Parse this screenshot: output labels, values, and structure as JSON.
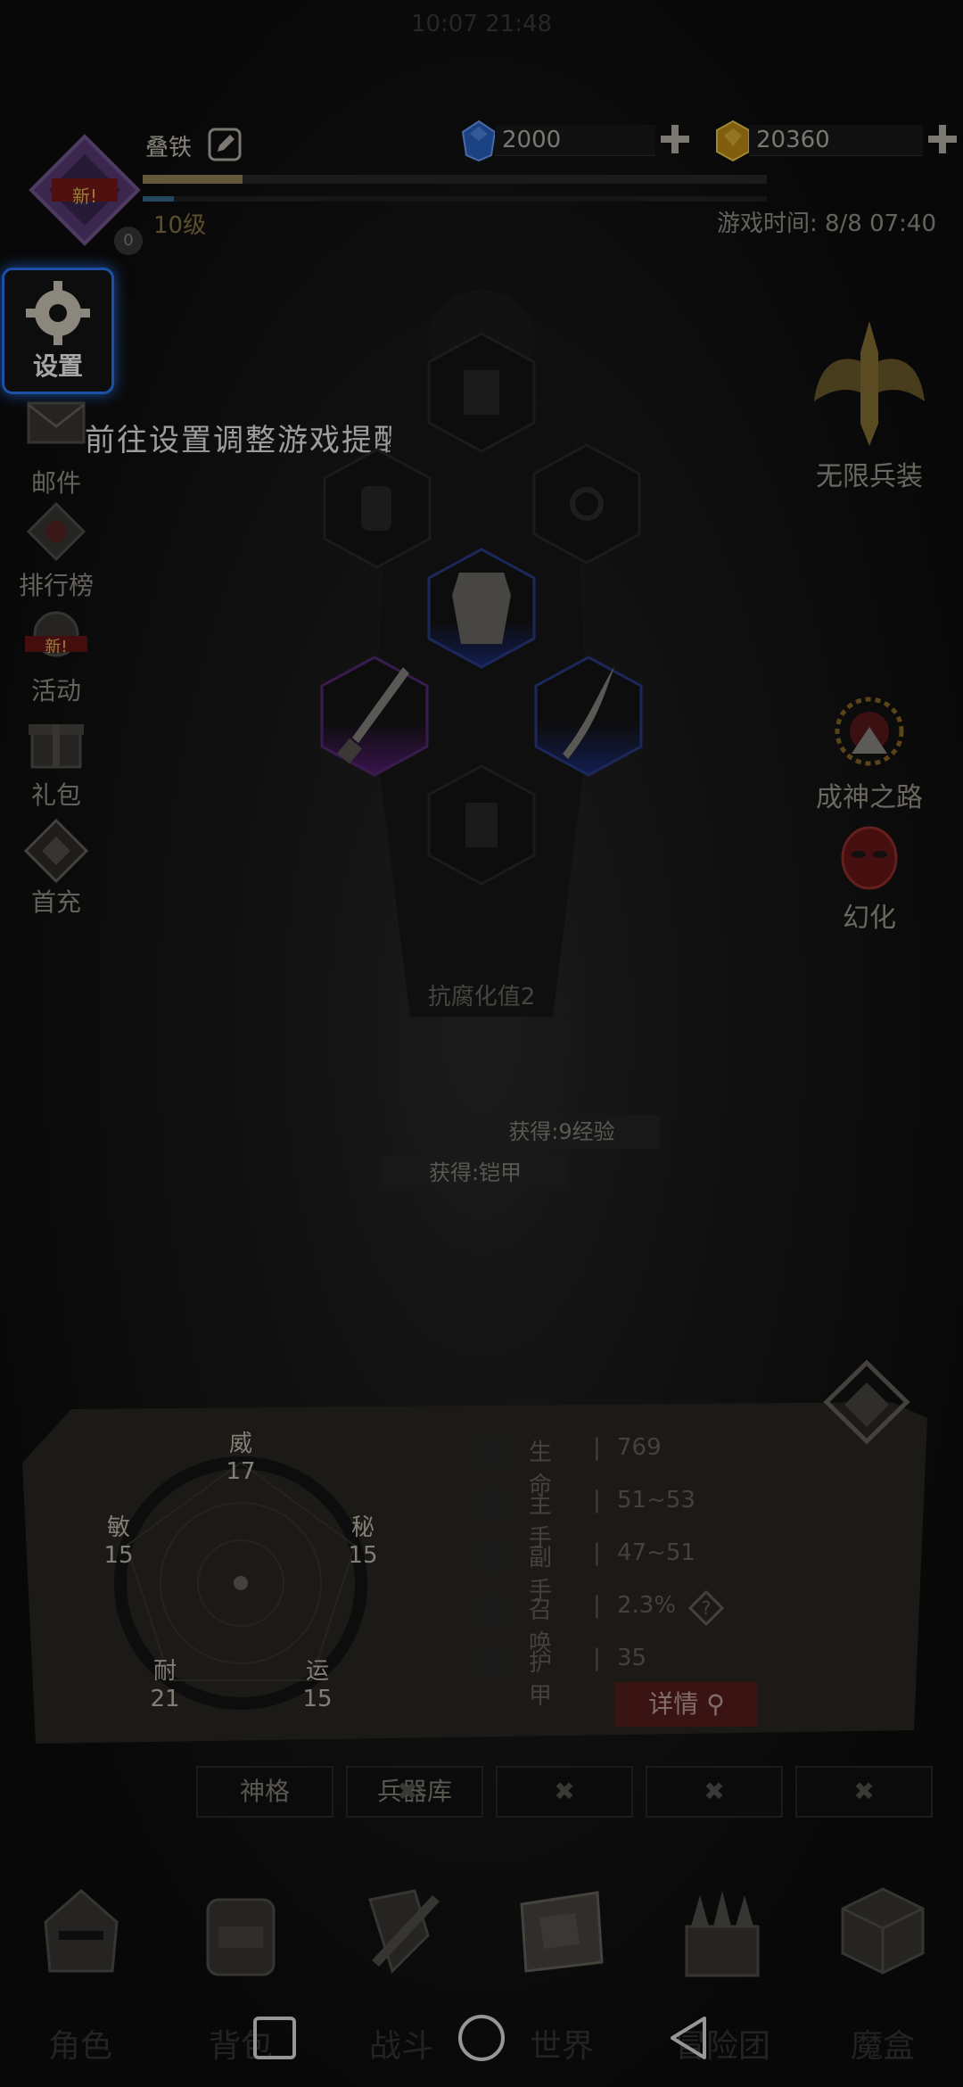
{
  "status_bar": {
    "time": "10:07 21:48"
  },
  "player": {
    "name": "叠铁",
    "level": "10级",
    "badge_new": "新!",
    "notification_count": "0"
  },
  "currency": {
    "gems": "2000",
    "gold": "20360"
  },
  "game_time": "游戏时间: 8/8 07:40",
  "left_menu": [
    {
      "label": "设置",
      "icon": "gear-icon"
    },
    {
      "label": "邮件",
      "icon": "envelope-icon"
    },
    {
      "label": "排行榜",
      "icon": "ranking-icon"
    },
    {
      "label": "活动",
      "icon": "activity-icon",
      "badge": "新!"
    },
    {
      "label": "礼包",
      "icon": "gift-icon"
    },
    {
      "label": "首充",
      "icon": "first-charge-icon"
    }
  ],
  "tooltip": "前往设置调整游戏提醒",
  "right_features": {
    "infinite_gear": "无限兵装",
    "god_path": "成神之路",
    "transform": "幻化"
  },
  "equipment": {
    "slots": [
      "helmet-slot",
      "gloves-slot",
      "ring-slot",
      "armor-slot",
      "main-hand-sword-slot",
      "off-hand-blade-slot",
      "boots-slot"
    ]
  },
  "corruption_label": "抗腐化值2",
  "notifications": {
    "exp_gain": "获得:9经验",
    "item_gain": "获得:铠甲"
  },
  "attributes": {
    "wei": {
      "name": "威",
      "value": "17"
    },
    "mi": {
      "name": "秘",
      "value": "15"
    },
    "yun": {
      "name": "运",
      "value": "15"
    },
    "nai": {
      "name": "耐",
      "value": "21"
    },
    "min": {
      "name": "敏",
      "value": "15"
    }
  },
  "stats": [
    {
      "name": "生命",
      "value": "769",
      "icon": "heart-icon"
    },
    {
      "name": "主手",
      "value": "51~53",
      "icon": "main-hand-icon"
    },
    {
      "name": "副手",
      "value": "47~51",
      "icon": "off-hand-icon"
    },
    {
      "name": "召唤",
      "value": "2.3%",
      "icon": "summon-icon"
    },
    {
      "name": "护甲",
      "value": "35",
      "icon": "armor-icon"
    }
  ],
  "detail_button": "详情",
  "tabs": [
    "神格",
    "兵器库",
    "",
    "",
    ""
  ],
  "bottom_nav": [
    "角色",
    "背包",
    "战斗",
    "世界",
    "冒险团",
    "魔盒"
  ],
  "colors": {
    "highlight": "#2b7bff",
    "gem": "#2a66c8",
    "gold": "#e3b020",
    "detail_bg": "#5a1e1e"
  }
}
